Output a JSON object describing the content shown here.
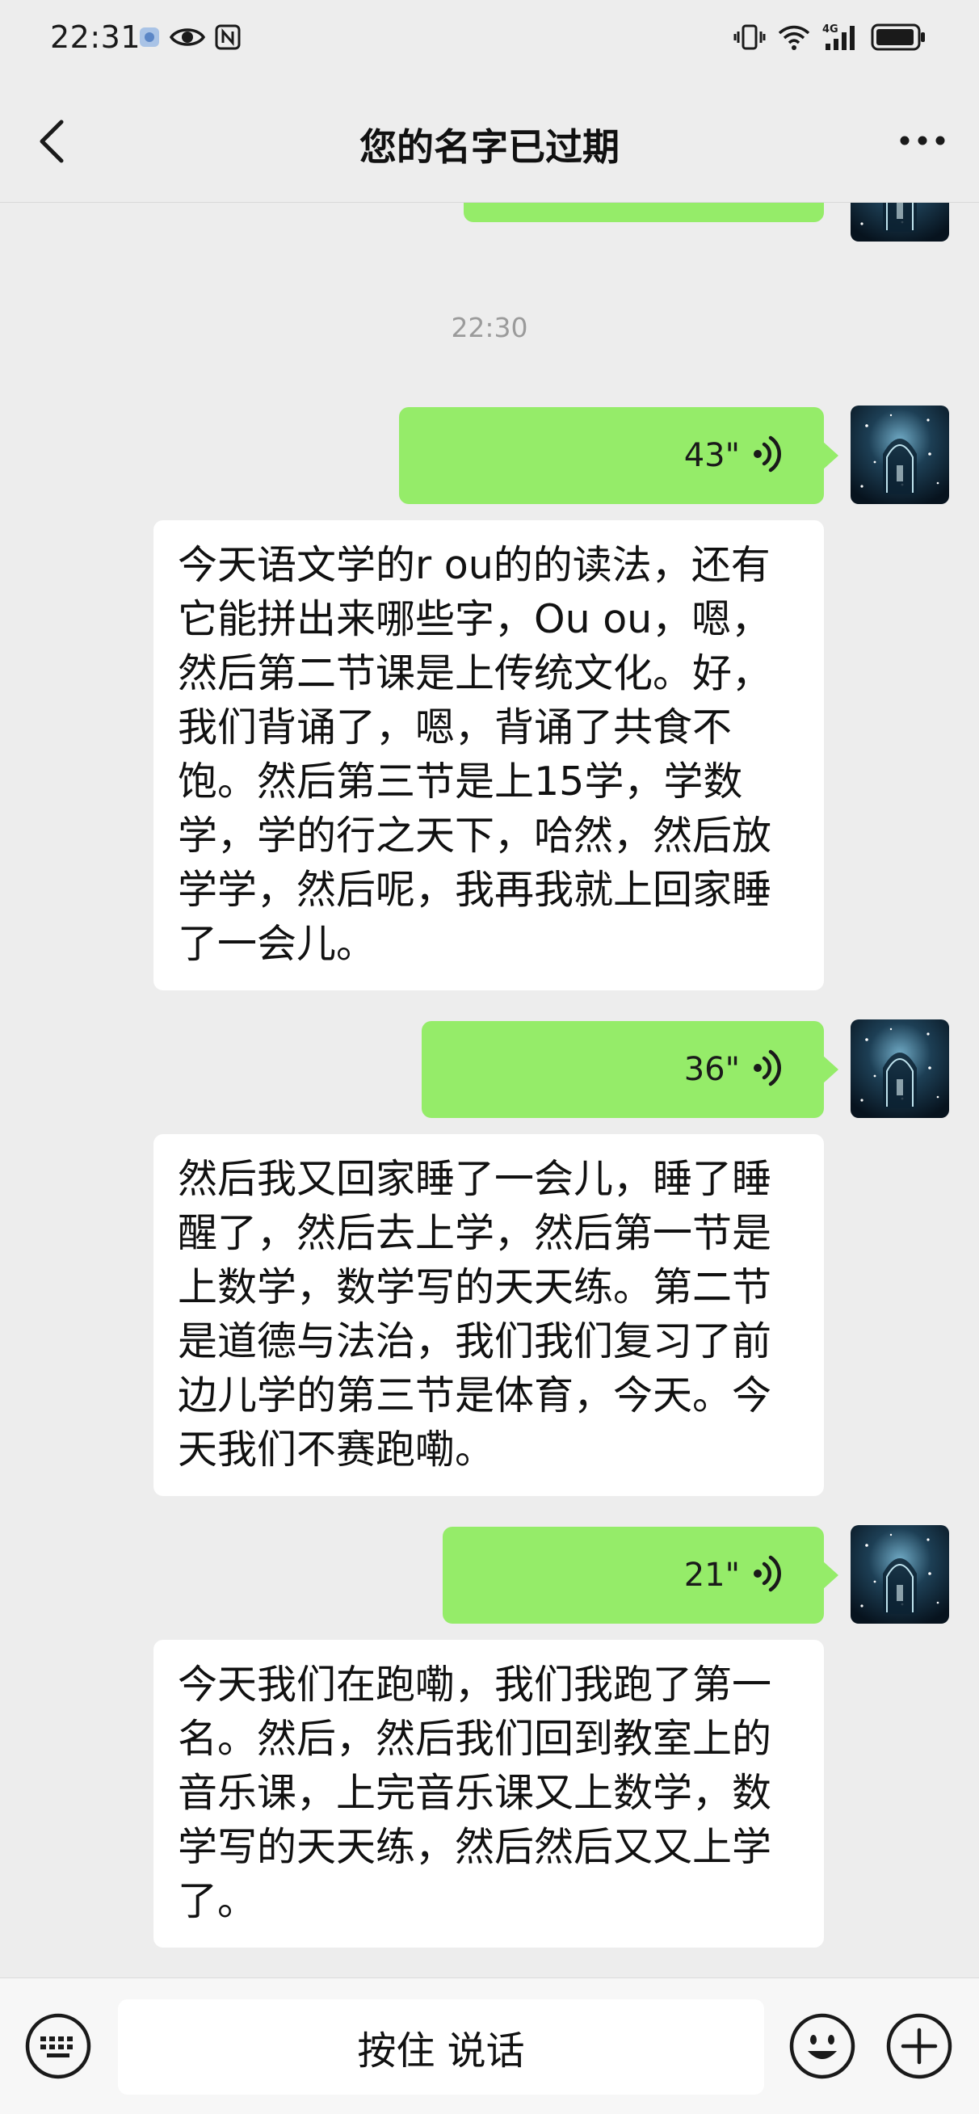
{
  "status_bar": {
    "time": "22:31",
    "left_icons": [
      "notification-dot-icon",
      "eye-icon",
      "nfc-icon"
    ],
    "right_icons": [
      "vibrate-icon",
      "wifi-icon",
      "signal-4g-icon",
      "battery-icon"
    ],
    "network_label": "4G"
  },
  "header": {
    "title": "您的名字已过期",
    "back_icon": "chevron-left-icon",
    "more_icon": "more-dots-icon"
  },
  "chat": {
    "timestamp": "22:30",
    "messages": [
      {
        "voice_duration": "43\"",
        "transcript": "今天语文学的r ou的的读法，还有它能拼出来哪些字，Ou ou，嗯，然后第二节课是上传统文化。好，我们背诵了，嗯，背诵了共食不饱。然后第三节是上15学，学数学，学的行之天下，哈然，然后放学学，然后呢，我再我就上回家睡了一会儿。"
      },
      {
        "voice_duration": "36\"",
        "transcript": "然后我又回家睡了一会儿，睡了睡醒了，然后去上学，然后第一节是上数学，数学写的天天练。第二节是道德与法治，我们我们复习了前边儿学的第三节是体育，今天。今天我们不赛跑嘞。"
      },
      {
        "voice_duration": "21\"",
        "transcript": "今天我们在跑嘞，我们我跑了第一名。然后，然后我们回到教室上的音乐课，上完音乐课又上数学，数学写的天天练，然后然后又又上学了。"
      }
    ]
  },
  "input_bar": {
    "hold_to_talk_label": "按住 说话",
    "keyboard_icon": "keyboard-icon",
    "emoji_icon": "emoji-icon",
    "plus_icon": "plus-icon"
  },
  "colors": {
    "background": "#ededed",
    "sent_bubble": "#95ec69",
    "received_bubble": "#ffffff",
    "timestamp_text": "#9b9b9b"
  }
}
